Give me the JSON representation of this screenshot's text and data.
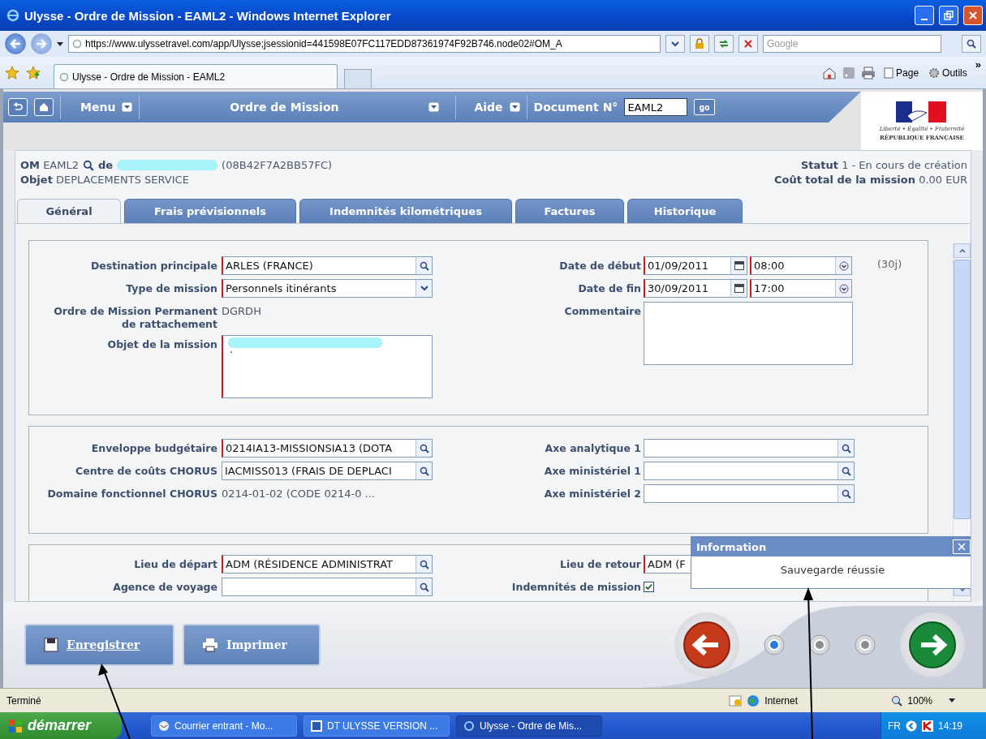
{
  "window": {
    "title": "Ulysse - Ordre de Mission - EAML2 - Windows Internet Explorer"
  },
  "browser": {
    "address": "https://www.ulyssetravel.com/app/Ulysse;jsessionid=441598E07FC117EDD87361974F92B746.node02#OM_A",
    "search_placeholder": "Google",
    "tab_title": "Ulysse - Ordre de Mission - EAML2",
    "commands": [
      {
        "label": "Page",
        "kind": "page"
      },
      {
        "label": "Outils",
        "kind": "tools"
      }
    ],
    "more": "»"
  },
  "app_nav": {
    "menu": "Menu",
    "title": "Ordre de Mission",
    "help": "Aide",
    "document_label": "Document N°",
    "document_value": "EAML2",
    "go": "go",
    "logo_motto": "Liberté • Égalité • Fraternité",
    "logo_name": "RÉPUBLIQUE FRANÇAISE"
  },
  "header": {
    "om_label": "OM",
    "om_value": "EAML2",
    "owner_label": "de",
    "owner_code": "(08B42F7A2BB57FC)",
    "object_label": "Objet",
    "object_value": "DEPLACEMENTS SERVICE",
    "status_label": "Statut",
    "status_value": "1 - En cours de création",
    "cost_label": "Coût total de la mission",
    "cost_value": "0.00 EUR"
  },
  "tabs": [
    {
      "label": "Général",
      "selected": true
    },
    {
      "label": "Frais prévisionnels",
      "selected": false
    },
    {
      "label": "Indemnités kilométriques",
      "selected": false
    },
    {
      "label": "Factures",
      "selected": false
    },
    {
      "label": "Historique",
      "selected": false
    }
  ],
  "sections": [
    {
      "left": [
        {
          "label": "Destination principale",
          "kind": "lookup",
          "value": "ARLES (FRANCE)",
          "required": true
        },
        {
          "label": "Type de mission",
          "kind": "select",
          "value": "Personnels itinérants",
          "required": true
        },
        {
          "label": "Ordre de Mission Permanent de rattachement",
          "kind": "static",
          "value": "DGRDH"
        },
        {
          "label": "Objet de la mission",
          "kind": "textarea",
          "value": ".",
          "required": true,
          "redacted": true
        }
      ],
      "right": [
        {
          "label": "Date de début",
          "kind": "datetime",
          "value": "01/09/2011",
          "time": "08:00",
          "required": true,
          "note": "(30j)"
        },
        {
          "label": "Date de fin",
          "kind": "datetime",
          "value": "30/09/2011",
          "time": "17:00",
          "required": true
        },
        {
          "label": "Commentaire",
          "kind": "textarea",
          "required": false
        }
      ]
    },
    {
      "left": [
        {
          "label": "Enveloppe budgétaire",
          "kind": "lookup",
          "value": "0214IA13-MISSIONSIA13 (DOTA",
          "required": true
        },
        {
          "label": "Centre de coûts CHORUS",
          "kind": "lookup",
          "value": "IACMISS013 (FRAIS DE DEPLACI",
          "required": false
        },
        {
          "label": "Domaine fonctionnel CHORUS",
          "kind": "static",
          "value": "0214-01-02 (CODE 0214-0 ..."
        }
      ],
      "right": [
        {
          "label": "Axe analytique 1",
          "kind": "lookup",
          "required": false
        },
        {
          "label": "Axe ministériel 1",
          "kind": "lookup",
          "required": false
        },
        {
          "label": "Axe ministériel 2",
          "kind": "lookup",
          "required": false
        }
      ]
    },
    {
      "left": [
        {
          "label": "Lieu de départ",
          "kind": "lookup",
          "value": "ADM (RÉSIDENCE ADMINISTRAT",
          "required": true
        },
        {
          "label": "Agence de voyage",
          "kind": "lookup",
          "required": false
        }
      ],
      "right": [
        {
          "label": "Lieu de retour",
          "kind": "covered",
          "value": "ADM (F",
          "required": true
        },
        {
          "label": "Indemnités de mission",
          "kind": "checkbox",
          "checked": true
        }
      ]
    }
  ],
  "popup": {
    "title": "Information",
    "message": "Sauvegarde réussie"
  },
  "actions": [
    {
      "label": "Enregistrer",
      "kind": "save"
    },
    {
      "label": "Imprimer",
      "kind": "print"
    }
  ],
  "steps": [
    {
      "selected": true
    },
    {
      "selected": false
    },
    {
      "selected": false
    }
  ],
  "status_bar": {
    "text": "Terminé",
    "zone": "Internet",
    "zoom": "100%"
  },
  "taskbar": {
    "start": "démarrer",
    "tasks": [
      {
        "label": "Courrier entrant - Mo...",
        "kind": "mail",
        "selected": false
      },
      {
        "label": "DT ULYSSE VERSION ...",
        "kind": "word",
        "selected": false
      },
      {
        "label": "Ulysse - Ordre de Mis...",
        "kind": "browser",
        "selected": true
      }
    ],
    "language": "FR",
    "time": "14:19"
  }
}
